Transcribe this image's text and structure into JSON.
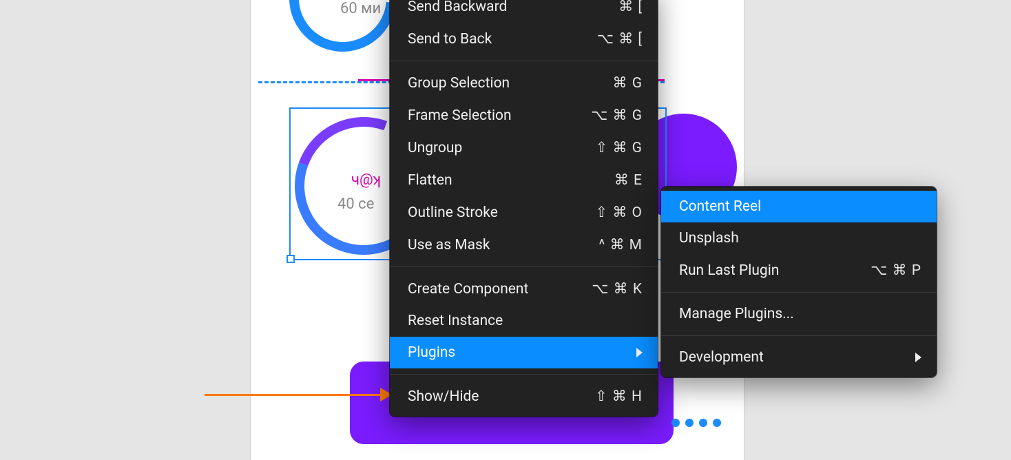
{
  "canvas": {
    "label_top": "60 ми",
    "mid_label1": "ч@ʞ",
    "mid_label2": "40 се"
  },
  "arrow": {
    "name": "annotation-arrow"
  },
  "menu": {
    "items": [
      {
        "label": "Send Backward",
        "shortcut": "⌘ ["
      },
      {
        "label": "Send to Back",
        "shortcut": "⌥ ⌘ ["
      }
    ],
    "group2": [
      {
        "label": "Group Selection",
        "shortcut": "⌘ G"
      },
      {
        "label": "Frame Selection",
        "shortcut": "⌥ ⌘ G"
      },
      {
        "label": "Ungroup",
        "shortcut": "⇧ ⌘ G"
      },
      {
        "label": "Flatten",
        "shortcut": "⌘ E"
      },
      {
        "label": "Outline Stroke",
        "shortcut": "⇧ ⌘ O"
      },
      {
        "label": "Use as Mask",
        "shortcut": "^ ⌘ M"
      }
    ],
    "group3": [
      {
        "label": "Create Component",
        "shortcut": "⌥ ⌘ K"
      },
      {
        "label": "Reset Instance",
        "shortcut": ""
      },
      {
        "label": "Plugins",
        "shortcut": "",
        "submenu": true,
        "highlight": true
      }
    ],
    "group4": [
      {
        "label": "Show/Hide",
        "shortcut": "⇧ ⌘ H"
      }
    ]
  },
  "submenu": {
    "group1": [
      {
        "label": "Content Reel",
        "shortcut": "",
        "highlight": true
      },
      {
        "label": "Unsplash",
        "shortcut": ""
      },
      {
        "label": "Run Last Plugin",
        "shortcut": "⌥ ⌘ P"
      }
    ],
    "group2": [
      {
        "label": "Manage Plugins...",
        "shortcut": ""
      }
    ],
    "group3": [
      {
        "label": "Development",
        "shortcut": "",
        "submenu": true
      }
    ]
  }
}
